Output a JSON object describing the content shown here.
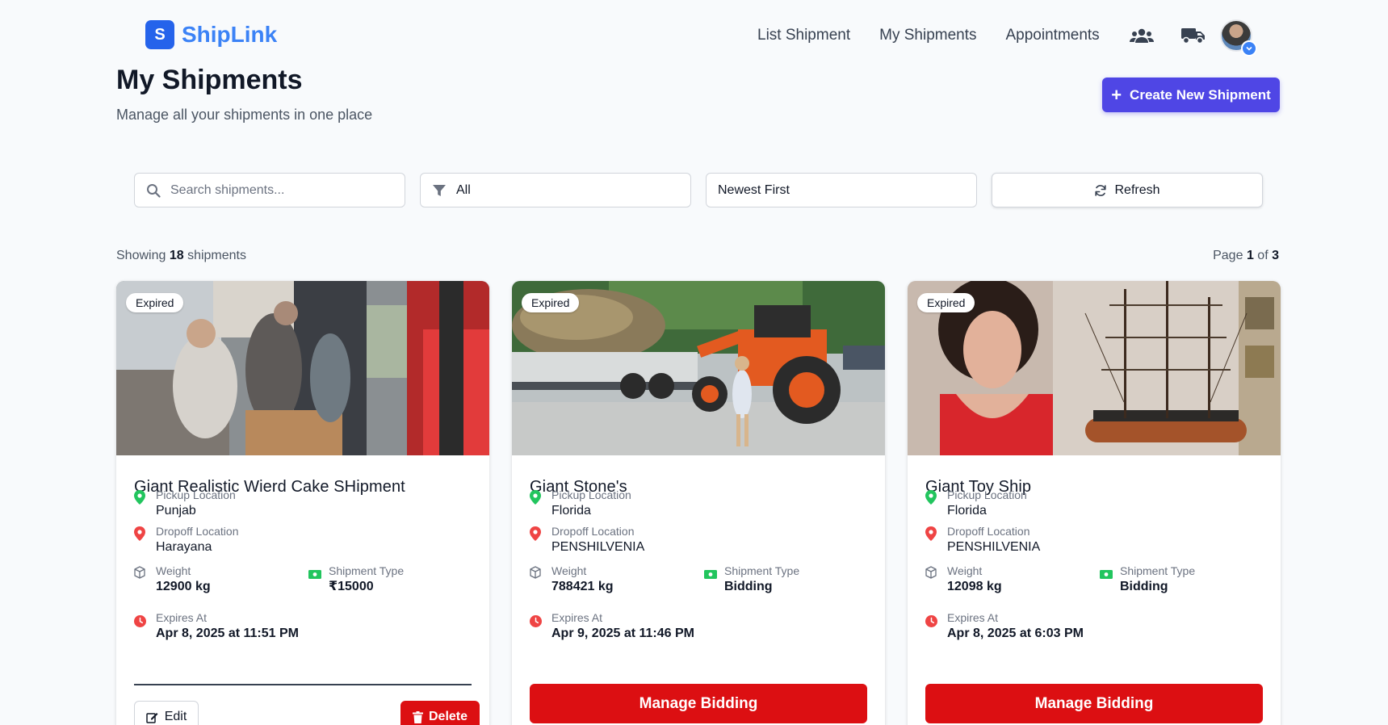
{
  "brand": {
    "logo_letter": "S",
    "name": "ShipLink",
    "accent": "#3b82f6"
  },
  "nav": {
    "links": [
      "List Shipment",
      "My Shipments",
      "Appointments"
    ],
    "icons": [
      "users-icon",
      "truck-icon"
    ],
    "avatar": "user-avatar"
  },
  "header": {
    "title": "My Shipments",
    "subtitle": "Manage all your shipments in one place",
    "create_label": "Create New Shipment"
  },
  "filters": {
    "search_placeholder": "Search shipments...",
    "status_value": "All",
    "sort_value": "Newest First",
    "refresh_label": "Refresh"
  },
  "summary": {
    "showing_prefix": "Showing",
    "count": "18",
    "showing_suffix": "shipments",
    "page_prefix": "Page",
    "page": "1",
    "page_of": "of",
    "total_pages": "3"
  },
  "labels": {
    "pickup": "Pickup Location",
    "dropoff": "Dropoff Location",
    "weight": "Weight",
    "type": "Shipment Type",
    "expires": "Expires At",
    "edit": "Edit",
    "delete": "Delete",
    "manage": "Manage Bidding"
  },
  "cards": [
    {
      "status": "Expired",
      "title": "Giant Realistic Wierd Cake SHipment",
      "pickup": "Punjab",
      "dropoff": "Harayana",
      "weight": "12900 kg",
      "type": "₹15000",
      "expires": "Apr 8, 2025 at 11:51 PM"
    },
    {
      "status": "Expired",
      "title": "Giant Stone's",
      "pickup": "Florida",
      "dropoff": "PENSHILVENIA",
      "weight": "788421 kg",
      "type": "Bidding",
      "expires": "Apr 9, 2025 at 11:46 PM"
    },
    {
      "status": "Expired",
      "title": "Giant Toy Ship",
      "pickup": "Florida",
      "dropoff": "PENSHILVENIA",
      "weight": "12098 kg",
      "type": "Bidding",
      "expires": "Apr 8, 2025 at 6:03 PM"
    }
  ],
  "colors": {
    "primary": "#4f46e5",
    "danger": "#dc0f12",
    "pickup": "#22c55e",
    "dropoff": "#ef4444"
  }
}
